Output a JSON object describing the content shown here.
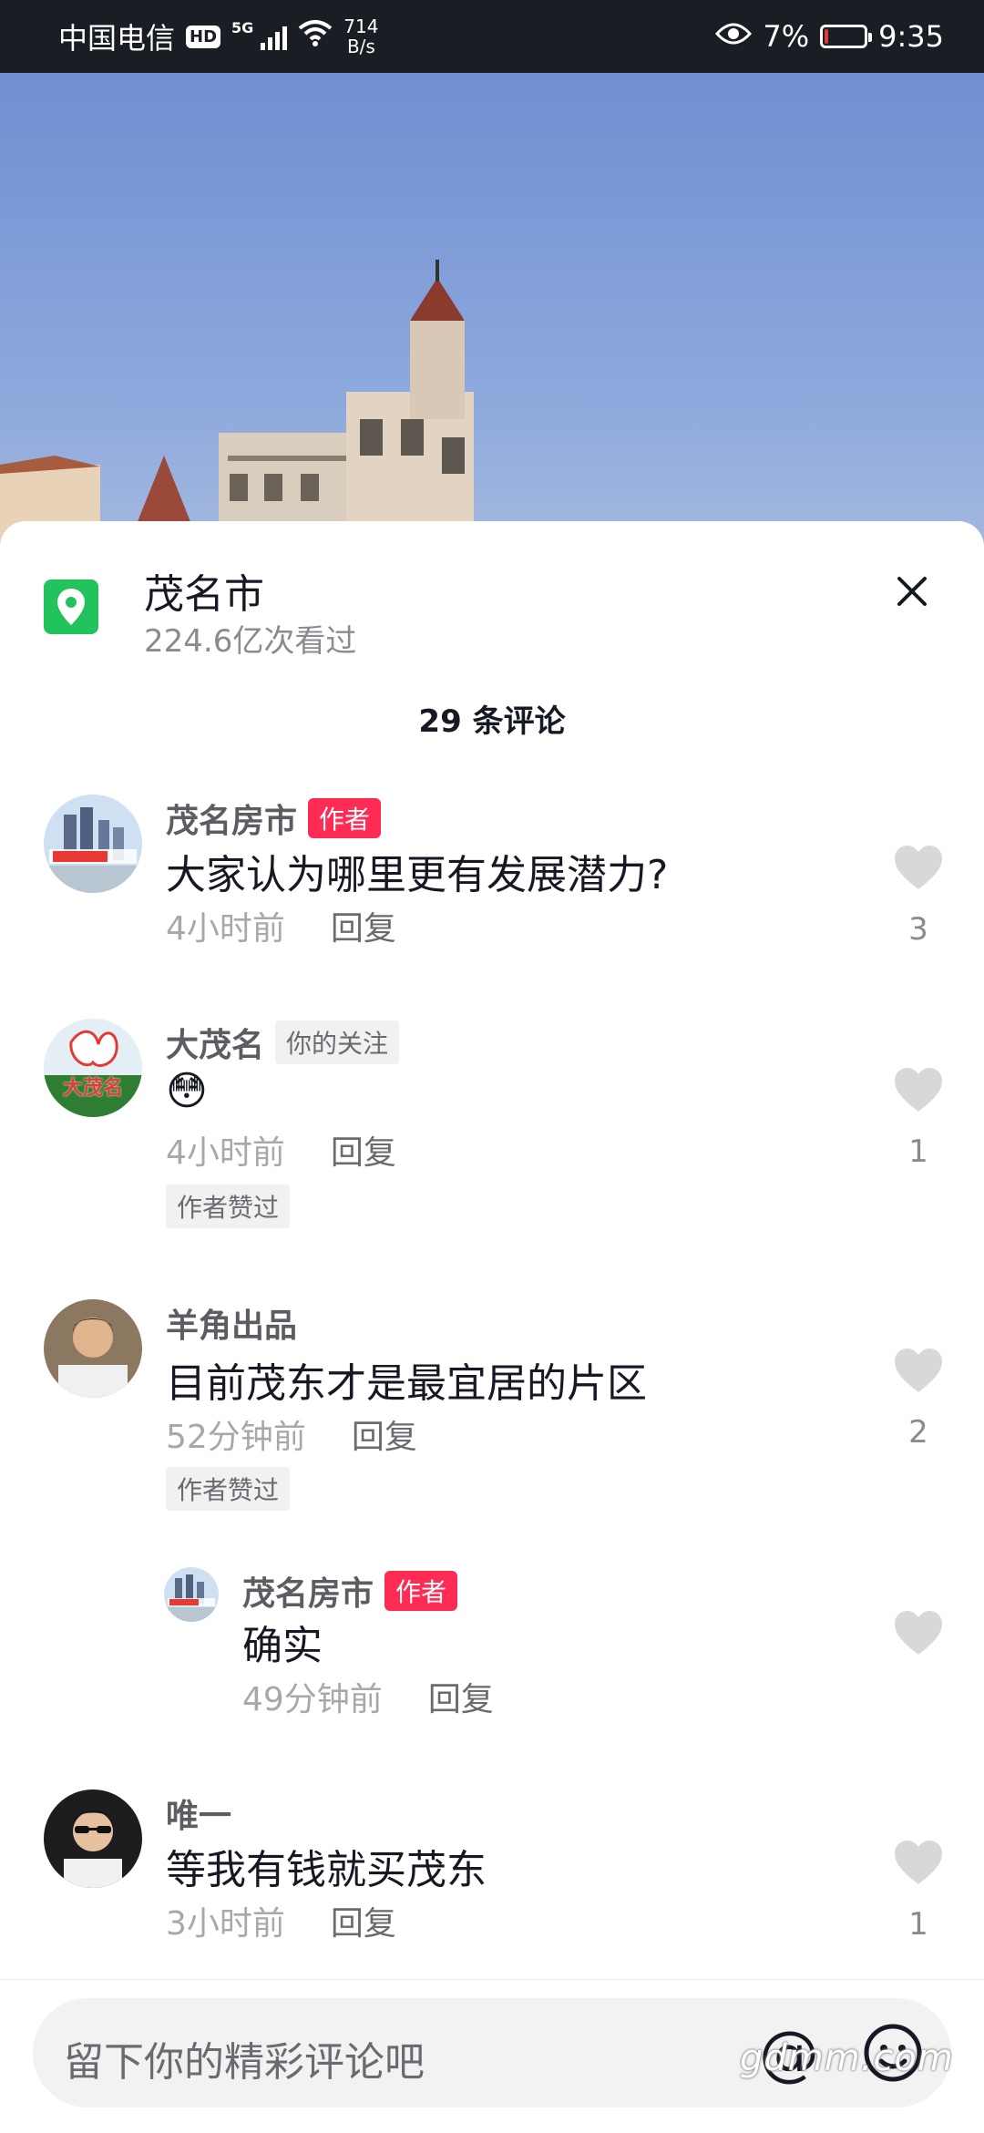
{
  "status_bar": {
    "carrier": "中国电信",
    "hd": "HD",
    "network": "5G",
    "speed_value": "714",
    "speed_unit": "B/s",
    "battery_percent": "7%",
    "battery_level": 0.07,
    "time": "9:35",
    "battery_color": "#e53935"
  },
  "location": {
    "name": "茂名市",
    "views": "224.6亿次看过",
    "icon": "location-pin-icon"
  },
  "comment_count": "29 条评论",
  "comments": [
    {
      "user": "茂名房市",
      "tag": "作者",
      "text": "大家认为哪里更有发展潜力?",
      "time": "4小时前",
      "reply": "回复",
      "likes": "3"
    },
    {
      "user": "大茂名",
      "tag": "你的关注",
      "text": "😳",
      "time": "4小时前",
      "reply": "回复",
      "likes": "1",
      "badge": "作者赞过",
      "avatar_text": "大茂名"
    },
    {
      "user": "羊角出品",
      "text": "目前茂东才是最宜居的片区",
      "time": "52分钟前",
      "reply": "回复",
      "likes": "2",
      "badge": "作者赞过"
    },
    {
      "user": "茂名房市",
      "tag": "作者",
      "text": "确实",
      "time": "49分钟前",
      "reply": "回复"
    },
    {
      "user": "唯一",
      "text": "等我有钱就买茂东",
      "time": "3小时前",
      "reply": "回复",
      "likes": "1"
    }
  ],
  "input": {
    "placeholder": "留下你的精彩评论吧"
  },
  "at_symbol": "@",
  "watermark": "gdmm.com",
  "colors": {
    "author_tag": "#fe2c55",
    "location_icon": "#22c25d",
    "status_bar": "#1b1d25",
    "heart": "#d8d8da"
  }
}
